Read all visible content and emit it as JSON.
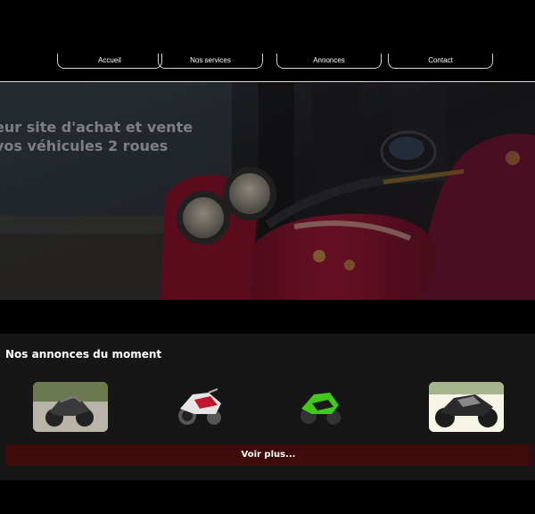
{
  "nav": {
    "items": [
      {
        "label": "Accueil"
      },
      {
        "label": "Nos services"
      },
      {
        "label": "Annonces"
      },
      {
        "label": "Contact"
      }
    ]
  },
  "hero": {
    "title_line1": "eur site d'achat et vente",
    "title_line2": "vos véhicules 2 roues",
    "image": "motorcycle-dashboard-photo"
  },
  "listings": {
    "title": "Nos annonces du moment",
    "items": [
      {
        "image": "motorcycle-black-gravel-photo"
      },
      {
        "image": "motorcycle-red-white-sport-photo"
      },
      {
        "image": "motorcycle-green-kawasaki-photo"
      },
      {
        "image": "motorcycle-black-yamaha-photo"
      }
    ],
    "more_label": "Voir plus..."
  },
  "colors": {
    "background": "#000000",
    "section_bg": "#161616",
    "button_bg": "#3f0a0a",
    "accent_red": "#a5102e"
  }
}
